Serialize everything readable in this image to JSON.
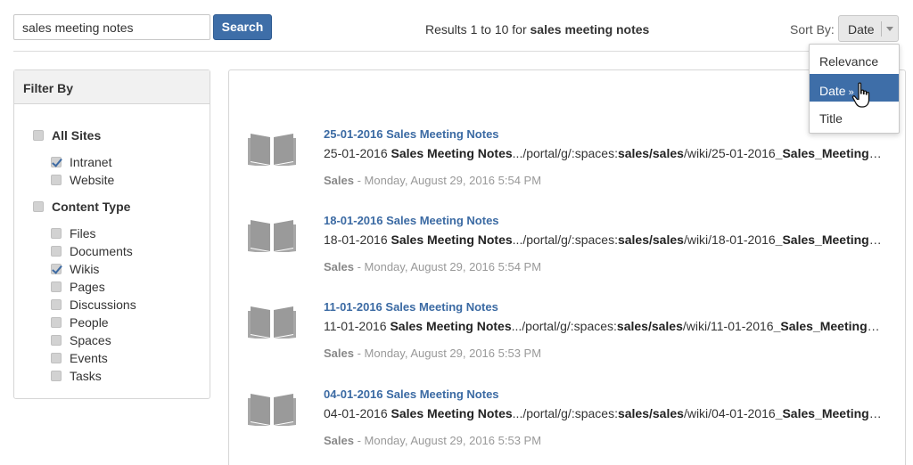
{
  "search": {
    "value": "sales meeting notes",
    "button_label": "Search"
  },
  "summary": {
    "prefix": "Results 1 to 10 for ",
    "query": "sales meeting notes"
  },
  "sort": {
    "label": "Sort By:",
    "selected": "Date",
    "options": [
      {
        "label": "Relevance",
        "active": false
      },
      {
        "label": "Date",
        "active": true,
        "arrow": "»"
      },
      {
        "label": "Title",
        "active": false
      }
    ]
  },
  "filter": {
    "title": "Filter By",
    "items": [
      {
        "label": "All Sites",
        "group": true,
        "checked": false
      },
      {
        "label": "Intranet",
        "group": false,
        "checked": true
      },
      {
        "label": "Website",
        "group": false,
        "checked": false
      },
      {
        "label": "Content Type",
        "group": true,
        "checked": false
      },
      {
        "label": "Files",
        "group": false,
        "checked": false
      },
      {
        "label": "Documents",
        "group": false,
        "checked": false
      },
      {
        "label": "Wikis",
        "group": false,
        "checked": true
      },
      {
        "label": "Pages",
        "group": false,
        "checked": false
      },
      {
        "label": "Discussions",
        "group": false,
        "checked": false
      },
      {
        "label": "People",
        "group": false,
        "checked": false
      },
      {
        "label": "Spaces",
        "group": false,
        "checked": false
      },
      {
        "label": "Events",
        "group": false,
        "checked": false
      },
      {
        "label": "Tasks",
        "group": false,
        "checked": false
      }
    ]
  },
  "results": [
    {
      "title": "25-01-2016 Sales Meeting Notes",
      "date_prefix": "25-01-2016 ",
      "bold_title": "Sales Meeting Notes",
      "path_prefix": ".../portal/g/:spaces:",
      "path_space": "sales/sales",
      "path_mid": "/wiki/25-01-2016",
      "path_page": "_Sales_Meeting_Notes",
      "meta_space": "Sales",
      "meta_date": " - Monday, August 29, 2016 5:54 PM"
    },
    {
      "title": "18-01-2016 Sales Meeting Notes",
      "date_prefix": "18-01-2016 ",
      "bold_title": "Sales Meeting Notes",
      "path_prefix": ".../portal/g/:spaces:",
      "path_space": "sales/sales",
      "path_mid": "/wiki/18-01-2016",
      "path_page": "_Sales_Meeting_Notes",
      "meta_space": "Sales",
      "meta_date": " - Monday, August 29, 2016 5:54 PM"
    },
    {
      "title": "11-01-2016 Sales Meeting Notes",
      "date_prefix": "11-01-2016 ",
      "bold_title": "Sales Meeting Notes",
      "path_prefix": ".../portal/g/:spaces:",
      "path_space": "sales/sales",
      "path_mid": "/wiki/11-01-2016",
      "path_page": "_Sales_Meeting_Notes",
      "meta_space": "Sales",
      "meta_date": " - Monday, August 29, 2016 5:53 PM"
    },
    {
      "title": "04-01-2016 Sales Meeting Notes",
      "date_prefix": "04-01-2016 ",
      "bold_title": "Sales Meeting Notes",
      "path_prefix": ".../portal/g/:spaces:",
      "path_space": "sales/sales",
      "path_mid": "/wiki/04-01-2016",
      "path_page": "_Sales_Meeting_Notes",
      "meta_space": "Sales",
      "meta_date": " - Monday, August 29, 2016 5:53 PM"
    }
  ],
  "icons": {
    "result": "book-icon",
    "pointer": "hand-pointer-icon"
  },
  "colors": {
    "accent": "#3e6ea8",
    "link": "#3b6aa3",
    "meta": "#999999"
  }
}
